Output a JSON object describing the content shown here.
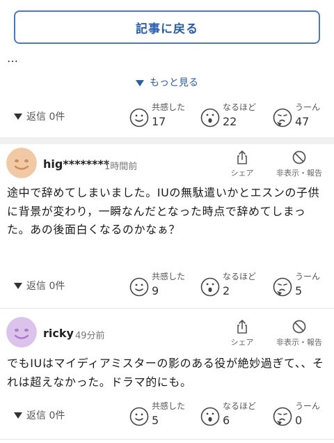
{
  "top": {
    "back_button": "記事に戻る",
    "ellipsis": "…",
    "more_link": "もっと見る",
    "reply": "返信 0件",
    "reactions": [
      {
        "label": "共感した",
        "count": "17"
      },
      {
        "label": "なるほど",
        "count": "22"
      },
      {
        "label": "うーん",
        "count": "47"
      }
    ]
  },
  "comments": [
    {
      "username": "hig********",
      "time": "1時間前",
      "share": "シェア",
      "hide": "非表示・報告",
      "body": "途中で辞めてしまいました。IUの無駄遣いかとエスンの子供に背景が変わり，一瞬なんだとなった時点で辞めてしまった。あの後面白くなるのかなぁ？",
      "reply": "返信 0件",
      "reactions": [
        {
          "label": "共感した",
          "count": "9"
        },
        {
          "label": "なるほど",
          "count": "2"
        },
        {
          "label": "うーん",
          "count": "5"
        }
      ],
      "avatar_color": "#f2c9a5"
    },
    {
      "username": "ricky",
      "time": "49分前",
      "share": "シェア",
      "hide": "非表示・報告",
      "body": "でもIUはマイディアミスターの影のある役が絶妙過ぎて、、それは超えなかった。ドラマ的にも。",
      "reply": "返信 0件",
      "reactions": [
        {
          "label": "共感した",
          "count": "5"
        },
        {
          "label": "なるほど",
          "count": "6"
        },
        {
          "label": "うーん",
          "count": "0"
        }
      ],
      "avatar_color": "#dcc3ec"
    }
  ],
  "colors": {
    "accent": "#2a5db0",
    "border": "#4a78c9"
  }
}
